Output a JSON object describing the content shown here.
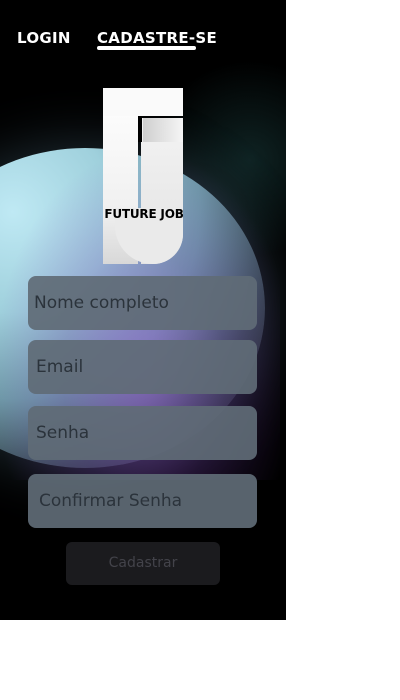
{
  "nav": {
    "tabs": [
      {
        "label": "LOGIN",
        "active": false
      },
      {
        "label": "CADASTRE-SE",
        "active": true
      }
    ]
  },
  "logo": {
    "monogram": "FJ",
    "text": "FUTURE JOB"
  },
  "form": {
    "fields": [
      {
        "placeholder": "Nome completo"
      },
      {
        "placeholder": "Email"
      },
      {
        "placeholder": "Senha"
      },
      {
        "placeholder": "Confirmar Senha"
      }
    ],
    "submit_label": "Cadastrar"
  },
  "colors": {
    "background": "#000000",
    "field_bg": "#5f6b76",
    "button_bg": "#1b1b1e",
    "orb": "#9fd0dc",
    "glow": "#a05adc"
  }
}
